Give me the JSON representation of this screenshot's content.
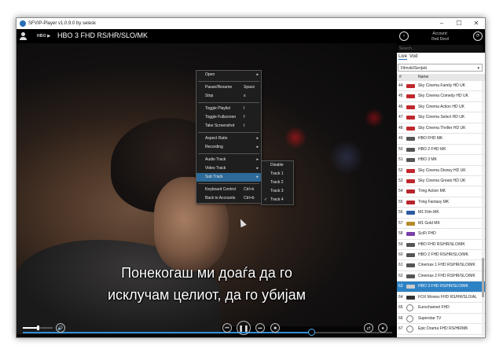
{
  "window": {
    "title": "SFVIP-Player v1.0.9.0 by selesk",
    "minimize": "–",
    "maximize": "☐",
    "close": "✕"
  },
  "player": {
    "channel_title": "HBO 3 FHD RS/HR/SLO/MK",
    "logo_text": "HBO ▶",
    "subtitle_line1": "Понекогаш ми доаѓа да го",
    "subtitle_line2": "исклучам целиот, да го убијам",
    "progress": 0.78,
    "volume": 0.48
  },
  "context_menu": {
    "items": [
      {
        "label": "Open",
        "shortcut": "",
        "arrow": "▸"
      },
      {
        "label": "Pause/Resume",
        "shortcut": "Space",
        "arrow": ""
      },
      {
        "label": "Stop",
        "shortcut": "s",
        "arrow": ""
      },
      {
        "label": "Toggle Playlist",
        "shortcut": "l",
        "arrow": ""
      },
      {
        "label": "Toggle Fullscreen",
        "shortcut": "f",
        "arrow": ""
      },
      {
        "label": "Take Screenshot",
        "shortcut": "t",
        "arrow": ""
      },
      {
        "label": "Aspect Ratio",
        "shortcut": "",
        "arrow": "▸"
      },
      {
        "label": "Recording",
        "shortcut": "",
        "arrow": "▸"
      },
      {
        "label": "Audio Track",
        "shortcut": "",
        "arrow": "▸"
      },
      {
        "label": "Video Track",
        "shortcut": "",
        "arrow": "▸"
      },
      {
        "label": "Sub Track",
        "shortcut": "",
        "arrow": "▸"
      },
      {
        "label": "Keyboard Control",
        "shortcut": "Ctrl+k",
        "arrow": ""
      },
      {
        "label": "Back to Accounts",
        "shortcut": "Ctrl+b",
        "arrow": ""
      }
    ]
  },
  "sub_menu": {
    "items": [
      {
        "label": "Disable",
        "check": ""
      },
      {
        "label": "Track 1",
        "check": ""
      },
      {
        "label": "Track 2",
        "check": ""
      },
      {
        "label": "Track 3",
        "check": ""
      },
      {
        "label": "Track 4",
        "check": "✓"
      }
    ]
  },
  "controls": {
    "prev": "⏮",
    "pause": "❚❚",
    "next": "⏭",
    "stop": "■",
    "volume_icon": "🔊",
    "shuffle": "⇄",
    "record": "●"
  },
  "sidebar": {
    "account_label": "Account:",
    "account_name": "Red Devil",
    "search_placeholder": "Search...",
    "tab_live": "Live",
    "tab_vod": "Vod",
    "category": "Filmski/Serijski",
    "category_arrow": "▾",
    "col_num": "#",
    "col_name": "Name",
    "back_icon": "›",
    "refresh_icon": "⟳",
    "channels": [
      {
        "num": "44",
        "name": "Sky Cinema Family HD UK",
        "logo": "#c0272d",
        "round": false
      },
      {
        "num": "45",
        "name": "Sky Cinema Comedy HD UK",
        "logo": "#c0272d",
        "round": false
      },
      {
        "num": "46",
        "name": "Sky Cinema Action HD UK",
        "logo": "#c0272d",
        "round": false
      },
      {
        "num": "47",
        "name": "Sky Cinema Select HD UK",
        "logo": "#c0272d",
        "round": false
      },
      {
        "num": "48",
        "name": "Sky Cinema Thriller HD UK",
        "logo": "#c0272d",
        "round": false
      },
      {
        "num": "49",
        "name": "HBO FHD MK",
        "logo": "#555555",
        "round": false
      },
      {
        "num": "50",
        "name": "HBO 2 FHD MK",
        "logo": "#555555",
        "round": false
      },
      {
        "num": "51",
        "name": "HBO 3 MK",
        "logo": "#555555",
        "round": false
      },
      {
        "num": "52",
        "name": "Sky Cinema Disney HD UK",
        "logo": "#c0272d",
        "round": false
      },
      {
        "num": "53",
        "name": "Sky Cinema Greats HD UK",
        "logo": "#c0272d",
        "round": false
      },
      {
        "num": "54",
        "name": "Tring Action MK",
        "logo": "#b8252b",
        "round": false
      },
      {
        "num": "55",
        "name": "Tring Fantasy MK",
        "logo": "#b8252b",
        "round": false
      },
      {
        "num": "56",
        "name": "M1 Film MK",
        "logo": "#2a5aa0",
        "round": false
      },
      {
        "num": "57",
        "name": "M1 Gold MK",
        "logo": "#b58a2a",
        "round": false
      },
      {
        "num": "58",
        "name": "SciFi FHD",
        "logo": "#7a3fa8",
        "round": false
      },
      {
        "num": "59",
        "name": "HBO FHD RS/HR/SLO/MK",
        "logo": "#555555",
        "round": false
      },
      {
        "num": "60",
        "name": "HBO 2 FHD RS/HR/SLO/MK",
        "logo": "#555555",
        "round": false
      },
      {
        "num": "61",
        "name": "Cinemax 1 FHD RS/HR/SLO/MK",
        "logo": "#555555",
        "round": false
      },
      {
        "num": "62",
        "name": "Cinemax 2 FHD RS/HR/SLO/MK",
        "logo": "#555555",
        "round": false
      },
      {
        "num": "63",
        "name": "HBO 3 FHD RS/HR/SLO/MK",
        "logo": "#cccccc",
        "round": false,
        "selected": true
      },
      {
        "num": "64",
        "name": "FOX Movies FHD RS/HR/SLO/AL",
        "logo": "#333333",
        "round": false
      },
      {
        "num": "65",
        "name": "Eurochannel FHD",
        "logo": "#ffffff",
        "round": true
      },
      {
        "num": "66",
        "name": "Superstar TV",
        "logo": "#ffffff",
        "round": true
      },
      {
        "num": "67",
        "name": "Epic Drama FHD RS/HR/MK",
        "logo": "#ffffff",
        "round": true
      }
    ]
  }
}
